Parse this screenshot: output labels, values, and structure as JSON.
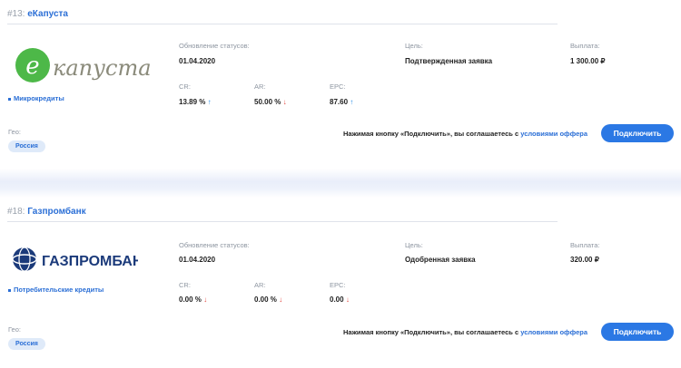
{
  "offers": [
    {
      "number": "#13:",
      "title": "еКапуста",
      "logo_text": "капуста",
      "logo_letter": "e",
      "category": "Микрокредиты",
      "status_update_label": "Обновление статусов:",
      "status_update_date": "01.04.2020",
      "goal_label": "Цель:",
      "goal_value": "Подтвержденная заявка",
      "payout_label": "Выплата:",
      "payout_value": "1 300.00 ₽",
      "cr_label": "CR:",
      "cr_value": "13.89 %",
      "cr_trend": "↑",
      "ar_label": "AR:",
      "ar_value": "50.00 %",
      "ar_trend": "↓",
      "epc_label": "EPC:",
      "epc_value": "87.60",
      "epc_trend": "↑",
      "geo_label": "Гео:",
      "geo_value": "Россия",
      "agree_text": "Нажимая кнопку «Подключить», вы соглашаетесь с ",
      "agree_link": "условиями оффера",
      "connect_label": "Подключить"
    },
    {
      "number": "#18:",
      "title": "Газпромбанк",
      "logo_text": "ГАЗПРОМБАНК",
      "category": "Потребительские кредиты",
      "status_update_label": "Обновление статусов:",
      "status_update_date": "01.04.2020",
      "goal_label": "Цель:",
      "goal_value": "Одобренная заявка",
      "payout_label": "Выплата:",
      "payout_value": "320.00 ₽",
      "cr_label": "CR:",
      "cr_value": "0.00 %",
      "cr_trend": "↓",
      "ar_label": "AR:",
      "ar_value": "0.00 %",
      "ar_trend": "↓",
      "epc_label": "EPC:",
      "epc_value": "0.00",
      "epc_trend": "↓",
      "geo_label": "Гео:",
      "geo_value": "Россия",
      "agree_text": "Нажимая кнопку «Подключить», вы соглашаетесь с ",
      "agree_link": "условиями оффера",
      "connect_label": "Подключить"
    }
  ],
  "colors": {
    "accent": "#2b78e4",
    "link": "#2b6fd6",
    "trend_up": "#2b8ee6",
    "trend_down": "#e2463e",
    "ekapusta_green": "#4db848",
    "gazprom_blue": "#1b3a7a"
  }
}
